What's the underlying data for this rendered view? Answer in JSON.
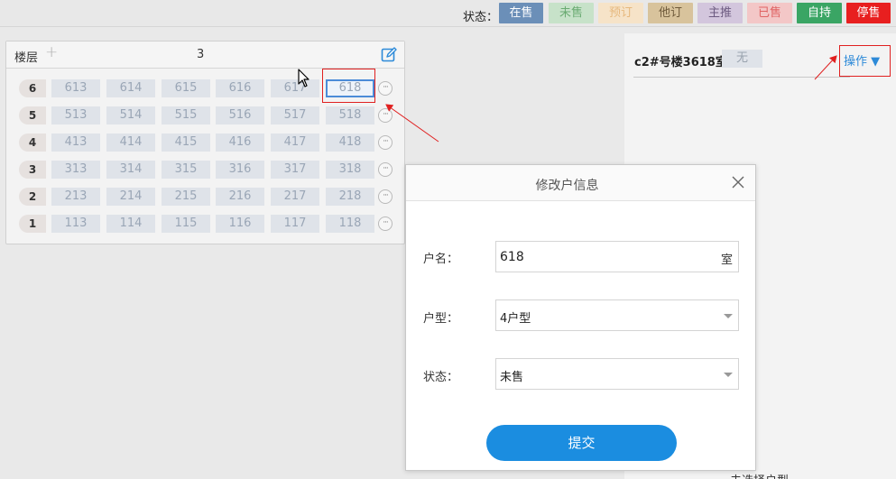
{
  "status_bar": {
    "label": "状态：",
    "buttons": [
      {
        "label": "在售",
        "bg": "#6b8fb8",
        "fg": "#ffffff"
      },
      {
        "label": "未售",
        "bg": "#c7e2c9",
        "fg": "#6aab72"
      },
      {
        "label": "预订",
        "bg": "#f6e3c8",
        "fg": "#e6b87d"
      },
      {
        "label": "他订",
        "bg": "#d8c39c",
        "fg": "#6e5a3a"
      },
      {
        "label": "主推",
        "bg": "#d3c6dd",
        "fg": "#6c5a80"
      },
      {
        "label": "已售",
        "bg": "#f3c7c7",
        "fg": "#e06363"
      },
      {
        "label": "自持",
        "bg": "#3aa564",
        "fg": "#ffffff"
      },
      {
        "label": "停售",
        "bg": "#e81f1f",
        "fg": "#ffffff"
      }
    ]
  },
  "floor_panel": {
    "title": "楼层",
    "count": "3",
    "floors": [
      {
        "num": "6",
        "units": [
          "613",
          "614",
          "615",
          "616",
          "617",
          "618"
        ]
      },
      {
        "num": "5",
        "units": [
          "513",
          "514",
          "515",
          "516",
          "517",
          "518"
        ]
      },
      {
        "num": "4",
        "units": [
          "413",
          "414",
          "415",
          "416",
          "417",
          "418"
        ]
      },
      {
        "num": "3",
        "units": [
          "313",
          "314",
          "315",
          "316",
          "317",
          "318"
        ]
      },
      {
        "num": "2",
        "units": [
          "213",
          "214",
          "215",
          "216",
          "217",
          "218"
        ]
      },
      {
        "num": "1",
        "units": [
          "113",
          "114",
          "115",
          "116",
          "117",
          "118"
        ]
      }
    ],
    "more_glyph": "···"
  },
  "right_panel": {
    "room_title": "c2#号楼3618室",
    "room_badge": "无",
    "operate_label": "操作 ▼",
    "cut_text": "未选择户型"
  },
  "modal": {
    "title": "修改户信息",
    "fields": {
      "name_label": "户名：",
      "name_value": "618",
      "name_suffix": "室",
      "type_label": "户型：",
      "type_value": "4户型",
      "status_label": "状态：",
      "status_value": "未售"
    },
    "submit_label": "提交"
  }
}
